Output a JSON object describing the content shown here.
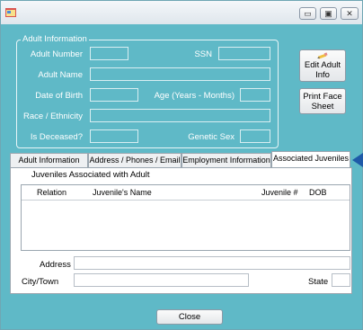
{
  "window": {
    "controls": {
      "minimize": "▭",
      "maximize": "▣",
      "close": "✕"
    }
  },
  "adult_info": {
    "legend": "Adult Information",
    "adult_number_label": "Adult Number",
    "ssn_label": "SSN",
    "adult_name_label": "Adult Name",
    "dob_label": "Date of Birth",
    "age_label": "Age (Years - Months)",
    "race_label": "Race / Ethnicity",
    "deceased_label": "Is Deceased?",
    "genetic_sex_label": "Genetic Sex"
  },
  "buttons": {
    "edit_line1": "Edit Adult",
    "edit_line2": "Info",
    "print_line1": "Print Face",
    "print_line2": "Sheet",
    "close": "Close"
  },
  "tabs": [
    {
      "label": "Adult Information"
    },
    {
      "label": "Address / Phones / Email"
    },
    {
      "label": "Employment Information"
    },
    {
      "label": "Associated Juveniles"
    }
  ],
  "juveniles": {
    "group_title": "Juveniles Associated with Adult",
    "columns": [
      "Relation",
      "Juvenile's Name",
      "Juvenile #",
      "DOB"
    ],
    "address_label": "Address",
    "city_label": "City/Town",
    "state_label": "State"
  }
}
